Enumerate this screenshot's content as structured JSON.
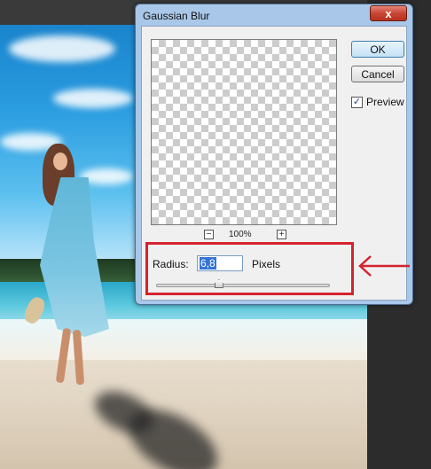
{
  "dialog": {
    "title": "Gaussian Blur",
    "close_glyph": "x",
    "ok_label": "OK",
    "cancel_label": "Cancel",
    "preview_label": "Preview",
    "preview_checked": true,
    "zoom": {
      "minus_glyph": "−",
      "plus_glyph": "+",
      "level": "100%"
    },
    "radius": {
      "label": "Radius:",
      "value": "6,8",
      "unit": "Pixels",
      "slider_fraction": 0.36
    }
  },
  "annotation": {
    "color": "#d5232f"
  }
}
